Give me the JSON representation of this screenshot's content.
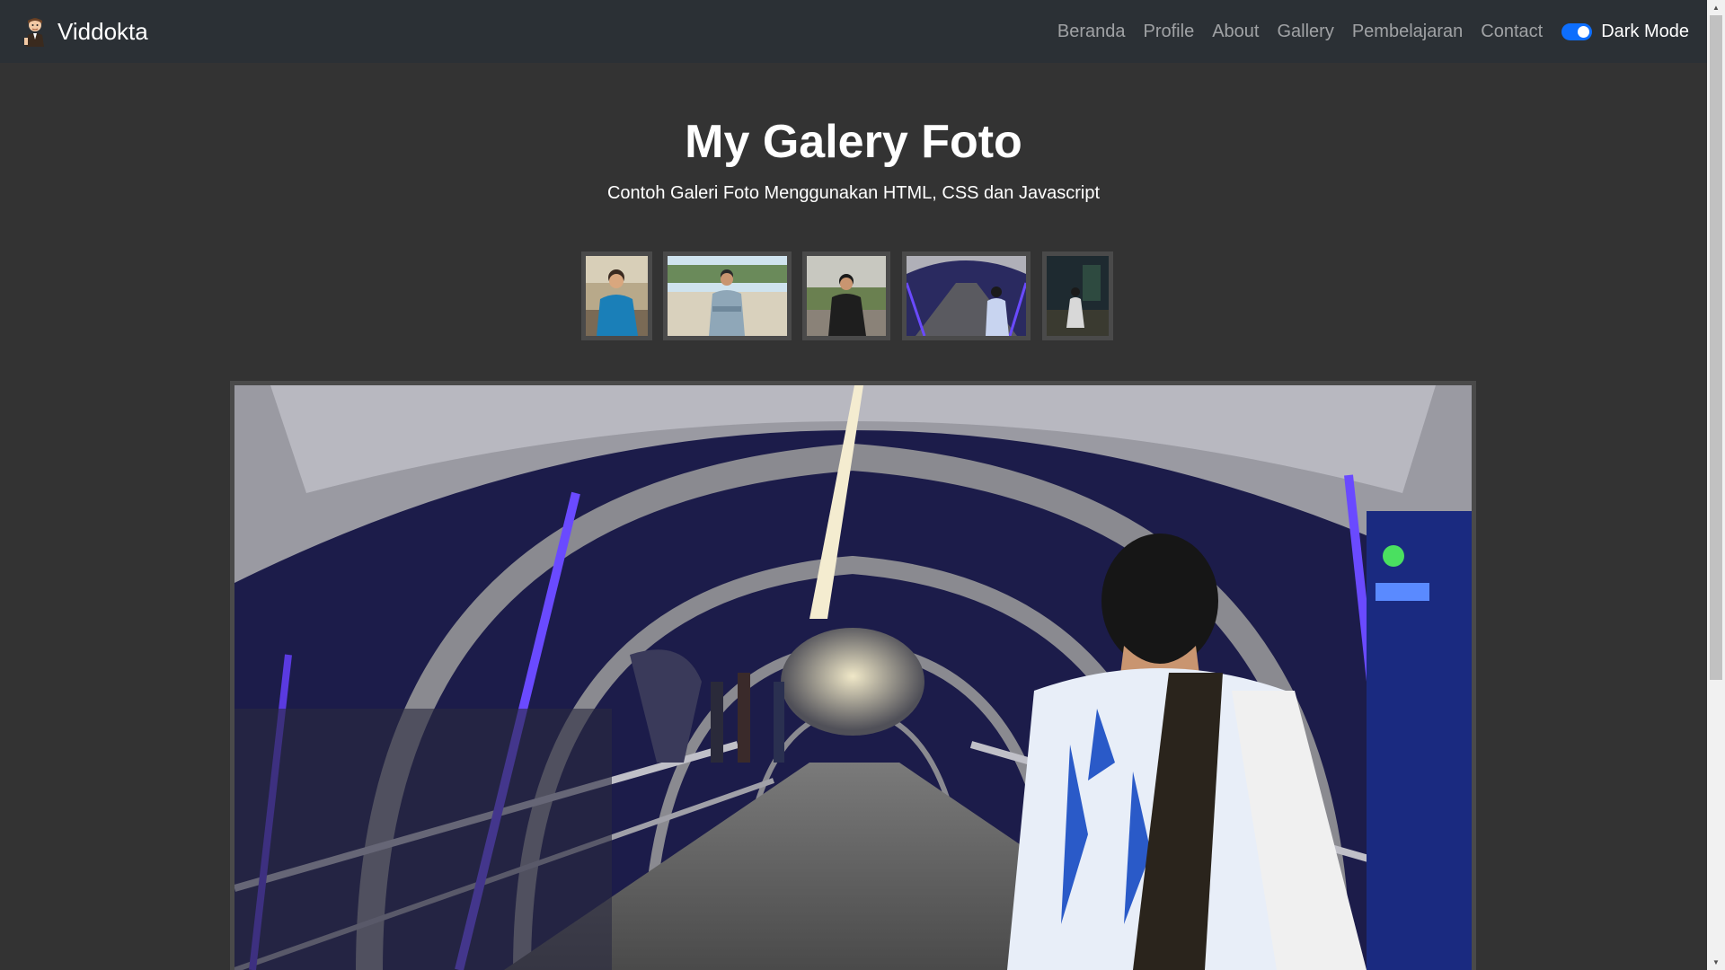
{
  "navbar": {
    "brand": "Viddokta",
    "links": [
      "Beranda",
      "Profile",
      "About",
      "Gallery",
      "Pembelajaran",
      "Contact"
    ],
    "toggle_label": "Dark Mode",
    "toggle_on": true
  },
  "header": {
    "title": "My Galery Foto",
    "subtitle": "Contoh Galeri Foto Menggunakan HTML, CSS dan Javascript"
  },
  "gallery": {
    "thumbnail_count": 5,
    "selected_index": 3
  },
  "colors": {
    "background": "#333333",
    "navbar": "#2b3035",
    "toggle_accent": "#0d6efd"
  }
}
